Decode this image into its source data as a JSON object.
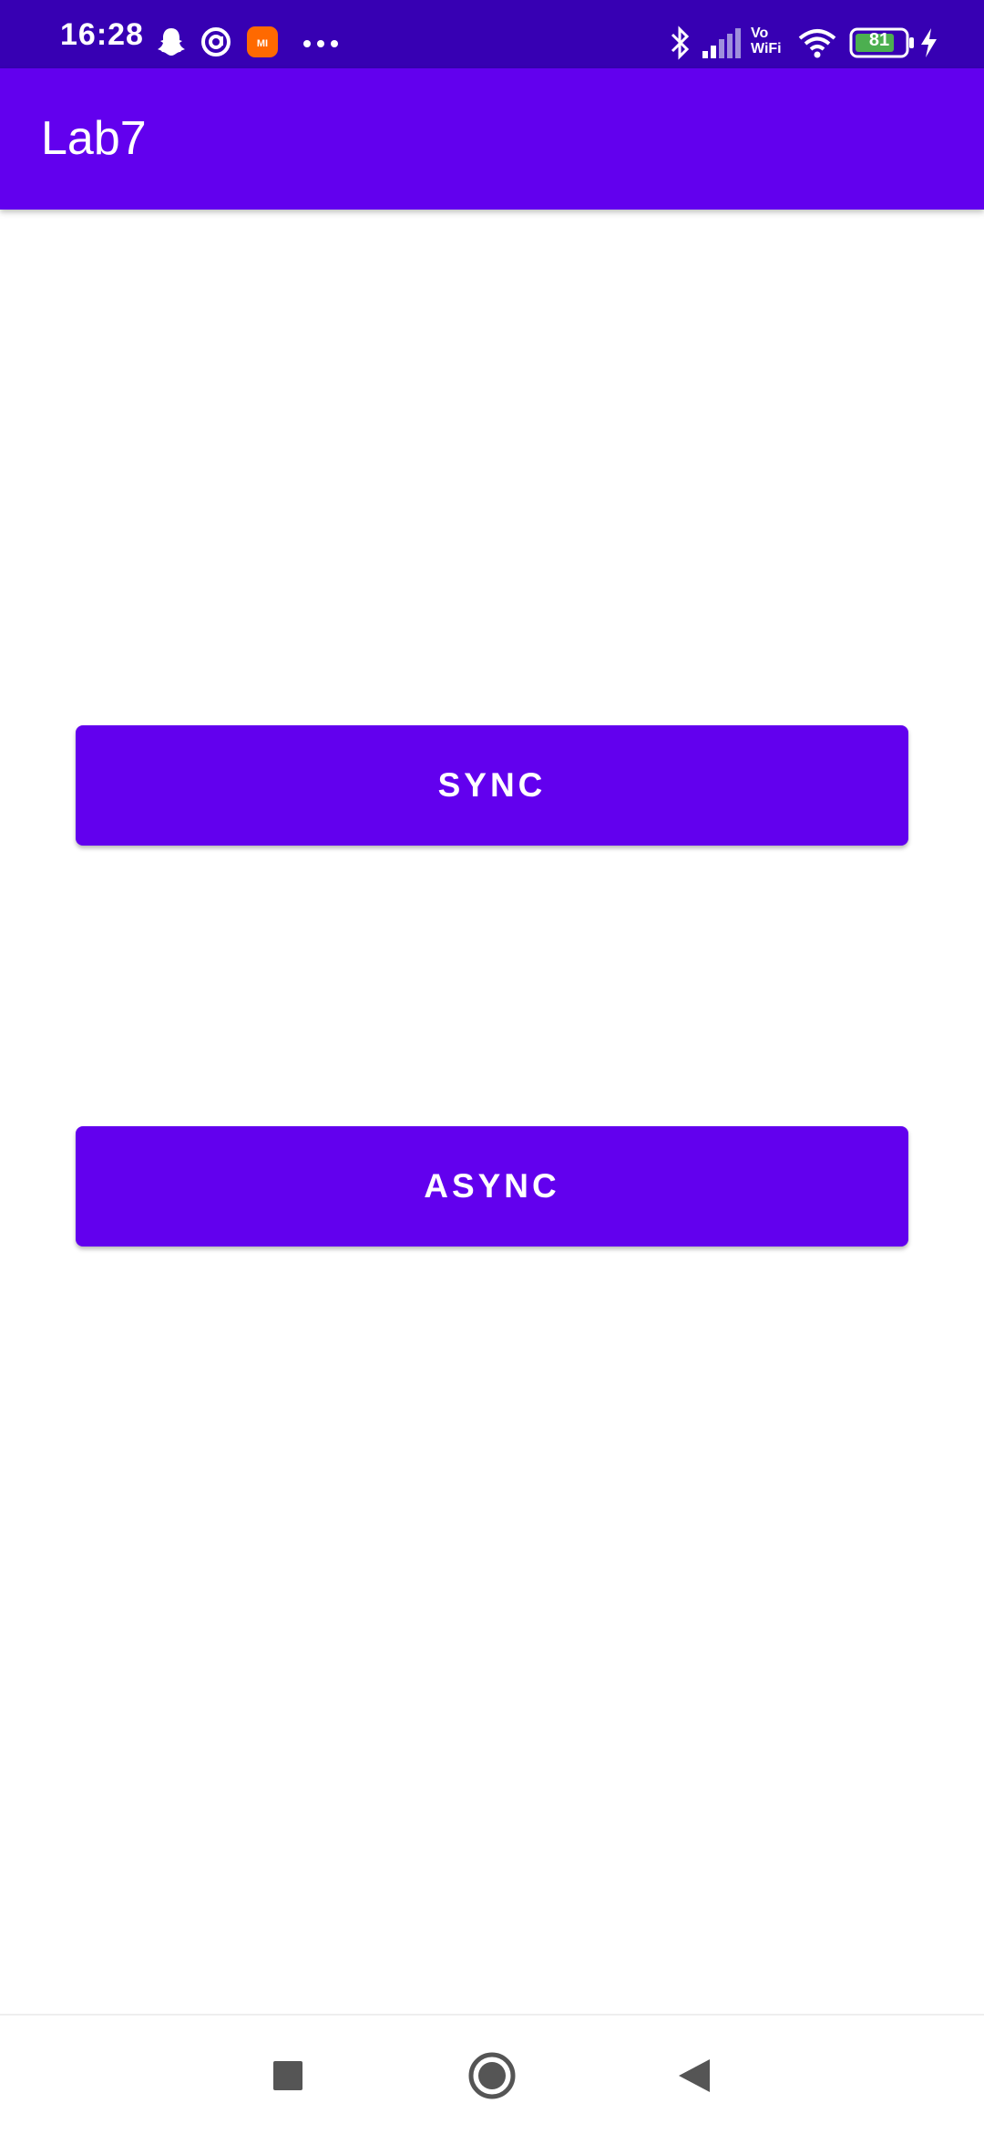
{
  "status_bar": {
    "time": "16:28",
    "notification_icons": [
      "snapchat-ghost-icon",
      "at-sign-icon",
      "mi-app-icon",
      "more-dots-icon"
    ],
    "mi_badge": "MI",
    "right_icons": [
      "bluetooth-icon",
      "cellular-signal-icon",
      "vowifi-icon",
      "wifi-icon",
      "battery-icon",
      "charging-bolt-icon"
    ],
    "vowifi_top": "Vo",
    "vowifi_bottom": "WiFi",
    "battery_level": "81",
    "colors": {
      "background": "#3700b3",
      "battery_fill": "#4caf50",
      "mi_icon": "#ff6900"
    }
  },
  "app_bar": {
    "title": "Lab7",
    "color": "#6200ee"
  },
  "buttons": {
    "sync_label": "SYNC",
    "async_label": "ASYNC",
    "color": "#6200ee"
  },
  "nav_bar": {
    "items": [
      "recents-square-icon",
      "home-circle-icon",
      "back-triangle-icon"
    ]
  }
}
